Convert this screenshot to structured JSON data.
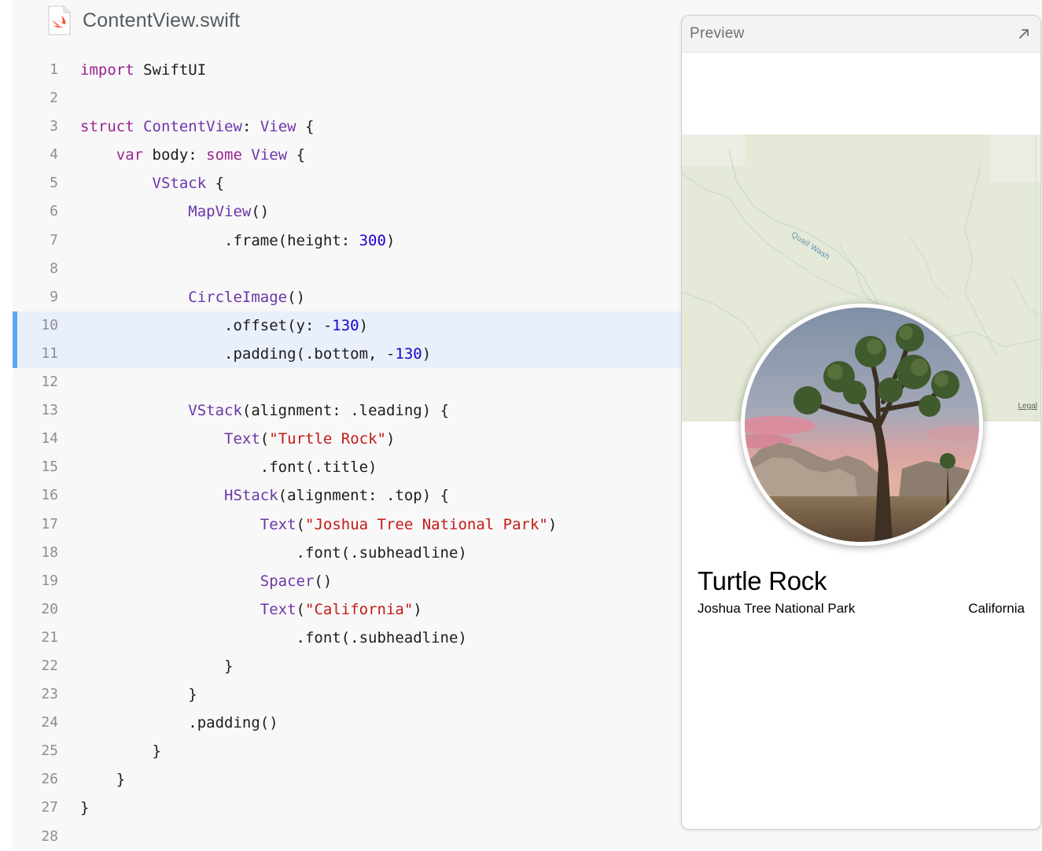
{
  "file": {
    "name": "ContentView.swift",
    "icon": "swift-file-icon"
  },
  "code_lines": [
    {
      "n": "1",
      "html": "<span class=\"kw\">import</span> SwiftUI"
    },
    {
      "n": "2",
      "html": ""
    },
    {
      "n": "3",
      "html": "<span class=\"kw\">struct</span> <span class=\"ty\">ContentView</span>: <span class=\"ty\">View</span> {"
    },
    {
      "n": "4",
      "html": "    <span class=\"kw\">var</span> body: <span class=\"kw\">some</span> <span class=\"ty\">View</span> {"
    },
    {
      "n": "5",
      "html": "        <span class=\"ty\">VStack</span> {"
    },
    {
      "n": "6",
      "html": "            <span class=\"ty\">MapView</span>()"
    },
    {
      "n": "7",
      "html": "                .frame(height: <span class=\"num\">300</span>)"
    },
    {
      "n": "8",
      "html": ""
    },
    {
      "n": "9",
      "html": "            <span class=\"ty\">CircleImage</span>()"
    },
    {
      "n": "10",
      "html": "                .offset(y: -<span class=\"num\">130</span>)",
      "highlight": true
    },
    {
      "n": "11",
      "html": "                .padding(.bottom, -<span class=\"num\">130</span>)",
      "highlight": true
    },
    {
      "n": "12",
      "html": ""
    },
    {
      "n": "13",
      "html": "            <span class=\"ty\">VStack</span>(alignment: .leading) {"
    },
    {
      "n": "14",
      "html": "                <span class=\"ty\">Text</span>(<span class=\"str\">\"Turtle Rock\"</span>)"
    },
    {
      "n": "15",
      "html": "                    .font(.title)"
    },
    {
      "n": "16",
      "html": "                <span class=\"ty\">HStack</span>(alignment: .top) {"
    },
    {
      "n": "17",
      "html": "                    <span class=\"ty\">Text</span>(<span class=\"str\">\"Joshua Tree National Park\"</span>)"
    },
    {
      "n": "18",
      "html": "                        .font(.subheadline)"
    },
    {
      "n": "19",
      "html": "                    <span class=\"ty\">Spacer</span>()"
    },
    {
      "n": "20",
      "html": "                    <span class=\"ty\">Text</span>(<span class=\"str\">\"California\"</span>)"
    },
    {
      "n": "21",
      "html": "                        .font(.subheadline)"
    },
    {
      "n": "22",
      "html": "                }"
    },
    {
      "n": "23",
      "html": "            }"
    },
    {
      "n": "24",
      "html": "            .padding()"
    },
    {
      "n": "25",
      "html": "        }"
    },
    {
      "n": "26",
      "html": "    }"
    },
    {
      "n": "27",
      "html": "}"
    },
    {
      "n": "28",
      "html": ""
    }
  ],
  "preview": {
    "title": "Preview",
    "expand_icon": "expand-arrow-icon",
    "map": {
      "wash_label": "Quail Wash",
      "legal": "Legal"
    },
    "circle_image": "joshua-tree-photo",
    "place_title": "Turtle Rock",
    "park": "Joshua Tree National Park",
    "state": "California"
  },
  "colors": {
    "keyword": "#9b2393",
    "type": "#6c36a9",
    "string": "#c41a16",
    "number": "#1c00cf",
    "line_highlight": "#e9f0fb",
    "highlight_bar": "#60a6f4",
    "map_land": "#e4ead7"
  }
}
